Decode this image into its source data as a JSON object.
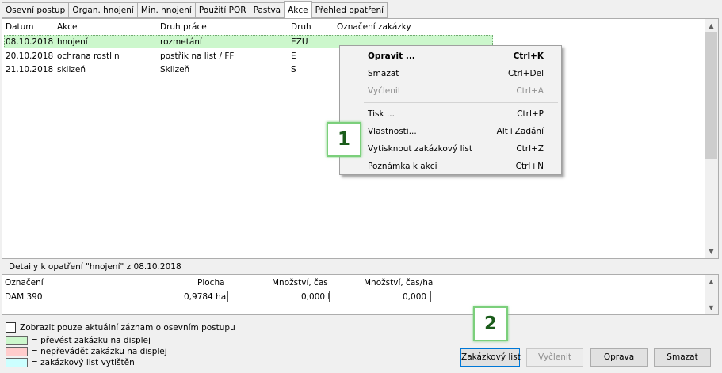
{
  "tabs": [
    "Osevní postup",
    "Organ. hnojení",
    "Min. hnojení",
    "Použití POR",
    "Pastva",
    "Akce",
    "Přehled opatření"
  ],
  "active_tab": "Akce",
  "grid": {
    "headers": {
      "datum": "Datum",
      "akce": "Akce",
      "druh_prace": "Druh práce",
      "druh": "Druh",
      "oznaceni": "Označení zakázky"
    },
    "rows": [
      {
        "datum": "08.10.2018",
        "akce": "hnojení",
        "druh_prace": "rozmetání",
        "druh": "EZU",
        "color": "#ccf7cc"
      },
      {
        "datum": "20.10.2018",
        "akce": "ochrana rostlin",
        "druh_prace": "postřik na list / FF",
        "druh": "E",
        "color": "#ffffff"
      },
      {
        "datum": "21.10.2018",
        "akce": "sklizeň",
        "druh_prace": "Sklizeň",
        "druh": "S",
        "color": "#ffffff"
      }
    ]
  },
  "context_menu": {
    "items": [
      {
        "label": "Opravit ...",
        "shortcut": "Ctrl+K",
        "bold": true,
        "disabled": false
      },
      {
        "label": "Smazat",
        "shortcut": "Ctrl+Del",
        "bold": false,
        "disabled": false
      },
      {
        "label": "Vyčlenit",
        "shortcut": "Ctrl+A",
        "bold": false,
        "disabled": true
      },
      {
        "label": "Tisk ...",
        "shortcut": "Ctrl+P",
        "bold": false,
        "disabled": false
      },
      {
        "label": "Vlastnosti...",
        "shortcut": "Alt+Zadání",
        "bold": false,
        "disabled": false
      },
      {
        "label": "Vytisknout zakázkový list",
        "shortcut": "Ctrl+Z",
        "bold": false,
        "disabled": false
      },
      {
        "label": "Poznámka k akci",
        "shortcut": "Ctrl+N",
        "bold": false,
        "disabled": false
      }
    ]
  },
  "callouts": {
    "one": "1",
    "two": "2"
  },
  "details": {
    "title": "Detaily k opatření \"hnojení\" z 08.10.2018",
    "headers": {
      "oznaceni": "Označení",
      "plocha": "Plocha",
      "mnozstvi": "Množství, čas",
      "mnozstvi_ha": "Množství, čas/ha"
    },
    "row": {
      "oznaceni": "DAM 390",
      "plocha": "0,9784 ha",
      "mnozstvi": "0,000 l",
      "mnozstvi_ha": "0,000 l"
    }
  },
  "checkbox_label": "Zobrazit pouze aktuální záznam o osevním postupu",
  "legend": [
    {
      "label": "= převést zakázku na displej",
      "color": "#ccf7cc"
    },
    {
      "label": "= nepřevádět zakázku na displej",
      "color": "#ffcccc"
    },
    {
      "label": "= zakázkový list vytištěn",
      "color": "#ccffff"
    }
  ],
  "buttons": {
    "zakazkovy_list": "Zakázkový list",
    "vyclenit": "Vyčlenit",
    "oprava": "Oprava",
    "smazat": "Smazat"
  },
  "icons": {
    "scroll_up": "scroll-up-icon",
    "scroll_down": "scroll-down-icon"
  }
}
